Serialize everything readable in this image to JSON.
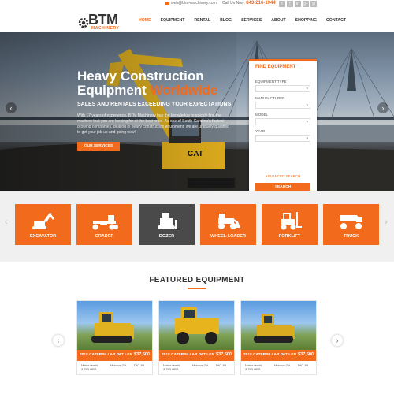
{
  "topbar": {
    "email": "web@btm-machinery.com",
    "call_label": "Call Us Now:",
    "phone": "843-216-1944",
    "social": [
      "f",
      "t",
      "in",
      "g+",
      "yt"
    ]
  },
  "logo": {
    "brand": "BTM",
    "sub": "MACHINERY"
  },
  "nav": [
    "HOME",
    "EQUIPMENT",
    "RENTAL",
    "BLOG",
    "SERVICES",
    "ABOUT",
    "SHOPPING",
    "CONTACT"
  ],
  "hero": {
    "title_line1": "Heavy Construction",
    "title_line2a": "Equipment ",
    "title_line2b": "Worldwide",
    "tagline": "SALES AND RENTALS EXCEEDING YOUR EXPECTATIONS",
    "description": "With 17 years of experience, BTM Machinery has the knowledge to quickly find the machine that you are looking for at the best price. As one of South Carolina's fastest growing companies, dealing in heavy construction equipment, we are uniquely qualified to get your job up and going now!",
    "cta": "OUR SERVICES",
    "prev": "‹",
    "next": "›"
  },
  "finder": {
    "title": "FIND EQUIPMENT",
    "fields": [
      "EQUIPMENT TYPE",
      "MANUFACTURER",
      "MODEL",
      "YEAR"
    ],
    "advanced": "ADVANCED SEARCH",
    "search": "SEARCH"
  },
  "categories": {
    "items": [
      "EXCAVATOR",
      "GRADER",
      "DOZER",
      "WHEEL-LOADER",
      "FORKLIFT",
      "TRUCK"
    ],
    "active_index": 2
  },
  "featured": {
    "heading": "FEATURED EQUIPMENT",
    "cards": [
      {
        "name": "2010 CATERPILLAR D6T LGP",
        "price": "$37,500",
        "hours_label": "Meter reads",
        "hours": "3,763 HRS",
        "location": "Monroe,GA",
        "stock": "D6T-88"
      },
      {
        "name": "2010 CATERPILLAR D6T LGP",
        "price": "$37,500",
        "hours_label": "Meter reads",
        "hours": "3,763 HRS",
        "location": "Monroe,GA",
        "stock": "D6T-88"
      },
      {
        "name": "2010 CATERPILLAR D6T LGP",
        "price": "$37,500",
        "hours_label": "Meter reads",
        "hours": "3,763 HRS",
        "location": "Monroe,GA",
        "stock": "D6T-88"
      }
    ],
    "prev": "‹",
    "next": "›"
  },
  "colors": {
    "accent": "#f26a1b",
    "dark": "#4a4a4a",
    "strip": "#f0f0f0"
  }
}
